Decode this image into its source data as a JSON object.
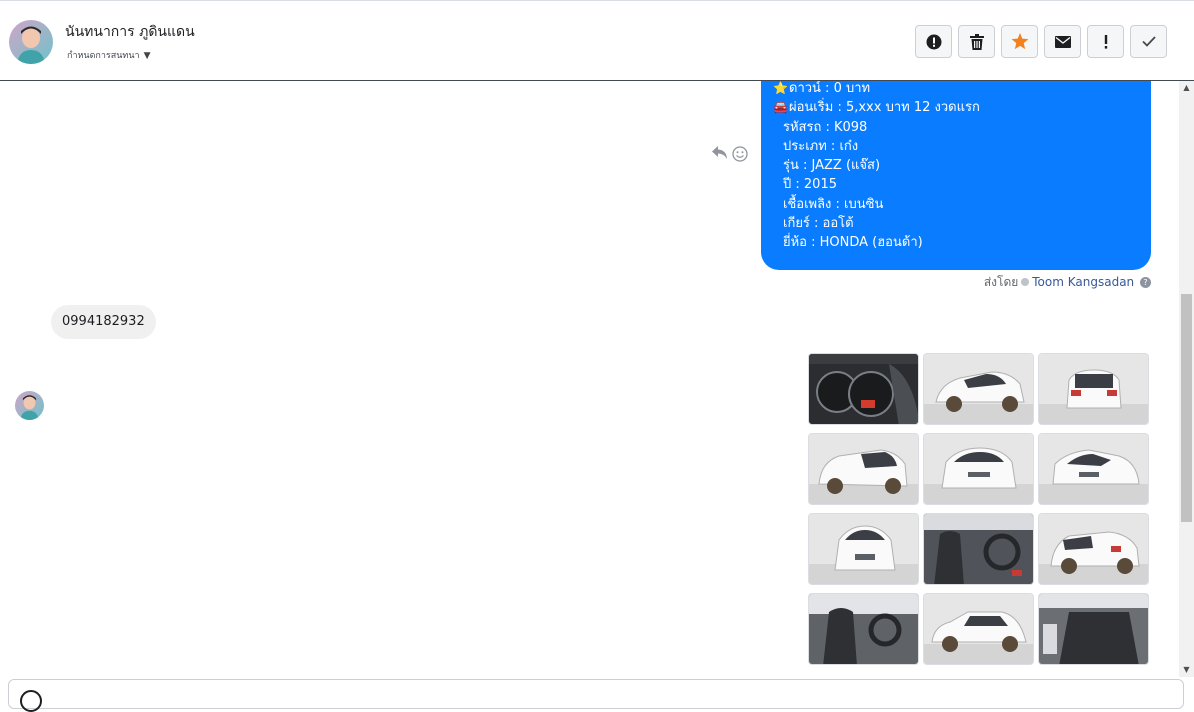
{
  "contact": {
    "name": "นันทนาการ ภูดินแดน",
    "status": "กำหนดการสนทนา"
  },
  "toolbar": {
    "buttons": [
      {
        "name": "alert-button",
        "icon": "exclamation-circle-icon"
      },
      {
        "name": "delete-button",
        "icon": "trash-icon"
      },
      {
        "name": "star-button",
        "icon": "star-icon"
      },
      {
        "name": "email-button",
        "icon": "envelope-icon"
      },
      {
        "name": "spam-button",
        "icon": "exclamation-icon"
      },
      {
        "name": "done-button",
        "icon": "check-icon"
      }
    ],
    "accent": "#f48120"
  },
  "outgoing_message": {
    "lines": [
      {
        "emoji": "⭐",
        "text": "ดาวน์ : 0 บาท"
      },
      {
        "emoji": "🚘",
        "text": "ผ่อนเริ่ม : 5,xxx บาท 12 งวดแรก"
      },
      {
        "emoji": "",
        "text": "รหัสรถ : K098"
      },
      {
        "emoji": "",
        "text": "ประเภท : เก๋ง"
      },
      {
        "emoji": "",
        "text": "รุ่น : JAZZ (แจ๊ส)"
      },
      {
        "emoji": "",
        "text": "ปี : 2015"
      },
      {
        "emoji": "",
        "text": "เชื้อเพลิง : เบนซิน"
      },
      {
        "emoji": "",
        "text": "เกียร์ : ออโต้"
      },
      {
        "emoji": "",
        "text": "ยี่ห้อ : HONDA (ฮอนด้า)"
      }
    ],
    "color": "#0a7cff"
  },
  "sent_by": {
    "prefix": "ส่งโดย",
    "name": "Toom Kangsadan"
  },
  "incoming_message": {
    "text": "0994182932"
  },
  "photos": [
    {
      "subject": "dashboard"
    },
    {
      "subject": "car-front-left"
    },
    {
      "subject": "car-rear"
    },
    {
      "subject": "car-rear-left"
    },
    {
      "subject": "car-front"
    },
    {
      "subject": "car-front-right"
    },
    {
      "subject": "car-front-straight"
    },
    {
      "subject": "interior-front-seats"
    },
    {
      "subject": "car-rear-right"
    },
    {
      "subject": "interior-driver-seat"
    },
    {
      "subject": "car-side"
    },
    {
      "subject": "interior-rear-seats"
    }
  ]
}
